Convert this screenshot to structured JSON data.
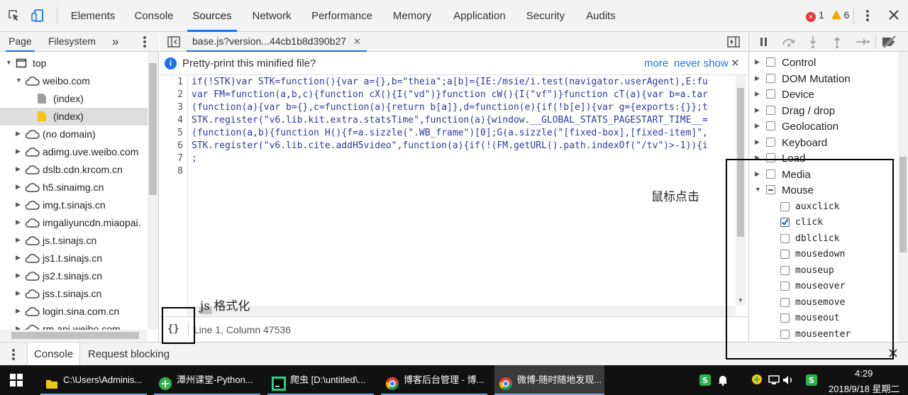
{
  "toolbar": {
    "tabs": [
      "Elements",
      "Console",
      "Sources",
      "Network",
      "Performance",
      "Memory",
      "Application",
      "Security",
      "Audits"
    ],
    "error_count": "1",
    "warning_count": "6"
  },
  "navigator": {
    "tabs": [
      "Page",
      "Filesystem"
    ],
    "more": "»",
    "items": [
      "top",
      "weibo.com",
      "(index)",
      "(index)",
      "(no domain)",
      "adimg.uve.weibo.com",
      "dslb.cdn.krcom.cn",
      "h5.sinaimg.cn",
      "img.t.sinajs.cn",
      "imgaliyuncdn.miaopai.",
      "js.t.sinajs.cn",
      "js1.t.sinajs.cn",
      "js2.t.sinajs.cn",
      "jss.t.sinajs.cn",
      "login.sina.com.cn",
      "rm.api.weibo.com"
    ]
  },
  "editor": {
    "file_tab": "base.js?version...44cb1b8d390b27",
    "infobar": {
      "message": "Pretty-print this minified file?",
      "more": "more",
      "never_show": "never show"
    },
    "line_numbers": [
      "1",
      "2",
      "3",
      "4",
      "5",
      "6",
      "7",
      "8"
    ],
    "lines": [
      "if(!STK)var STK=function(){var a={},b=\"theia\";a[b]={IE:/msie/i.test(navigator.userAgent),E:fu",
      "var FM=function(a,b,c){function cX(){I(\"vd\")}function cW(){I(\"vf\")}function cT(a){var b=a.tar",
      "(function(a){var b={},c=function(a){return b[a]},d=function(e){if(!b[e]){var g={exports:{}};t",
      "STK.register(\"v6.lib.kit.extra.statsTime\",function(a){window.__GLOBAL_STATS_PAGESTART_TIME__=",
      "(function(a,b){function H(){f=a.sizzle(\".WB_frame\")[0];G(a.sizzle(\"[fixed-box],[fixed-item]\",",
      "STK.register(\"v6.lib.cite.addH5video\",function(a){if(!(FM.getURL().path.indexOf(\"/tv\")>-1)){i",
      ";",
      ""
    ],
    "pretty_print_button": "{}",
    "status": "Line 1, Column 47536"
  },
  "breakpoints": {
    "categories": [
      "Control",
      "DOM Mutation",
      "Device",
      "Drag / drop",
      "Geolocation",
      "Keyboard",
      "Load",
      "Media",
      "Mouse"
    ],
    "mouse_events": [
      "auxclick",
      "click",
      "dblclick",
      "mousedown",
      "mouseup",
      "mouseover",
      "mousemove",
      "mouseout",
      "mouseenter"
    ],
    "checked": "click"
  },
  "drawer": {
    "tabs": [
      "Console",
      "Request blocking"
    ]
  },
  "taskbar": {
    "items": [
      "C:\\Users\\Adminis...",
      "潭州课堂-Python...",
      "爬虫 [D:\\untitled\\...",
      "博客后台管理 - 博...",
      "微博-随时随地发现..."
    ],
    "time": "4:29",
    "date": "2018/9/18 星期二"
  },
  "annotations": {
    "format_note": "js 格式化",
    "click_note": "鼠标点击"
  },
  "colors": {
    "accent": "#1a73e8",
    "error": "#e53935",
    "warning": "#f2a600"
  }
}
